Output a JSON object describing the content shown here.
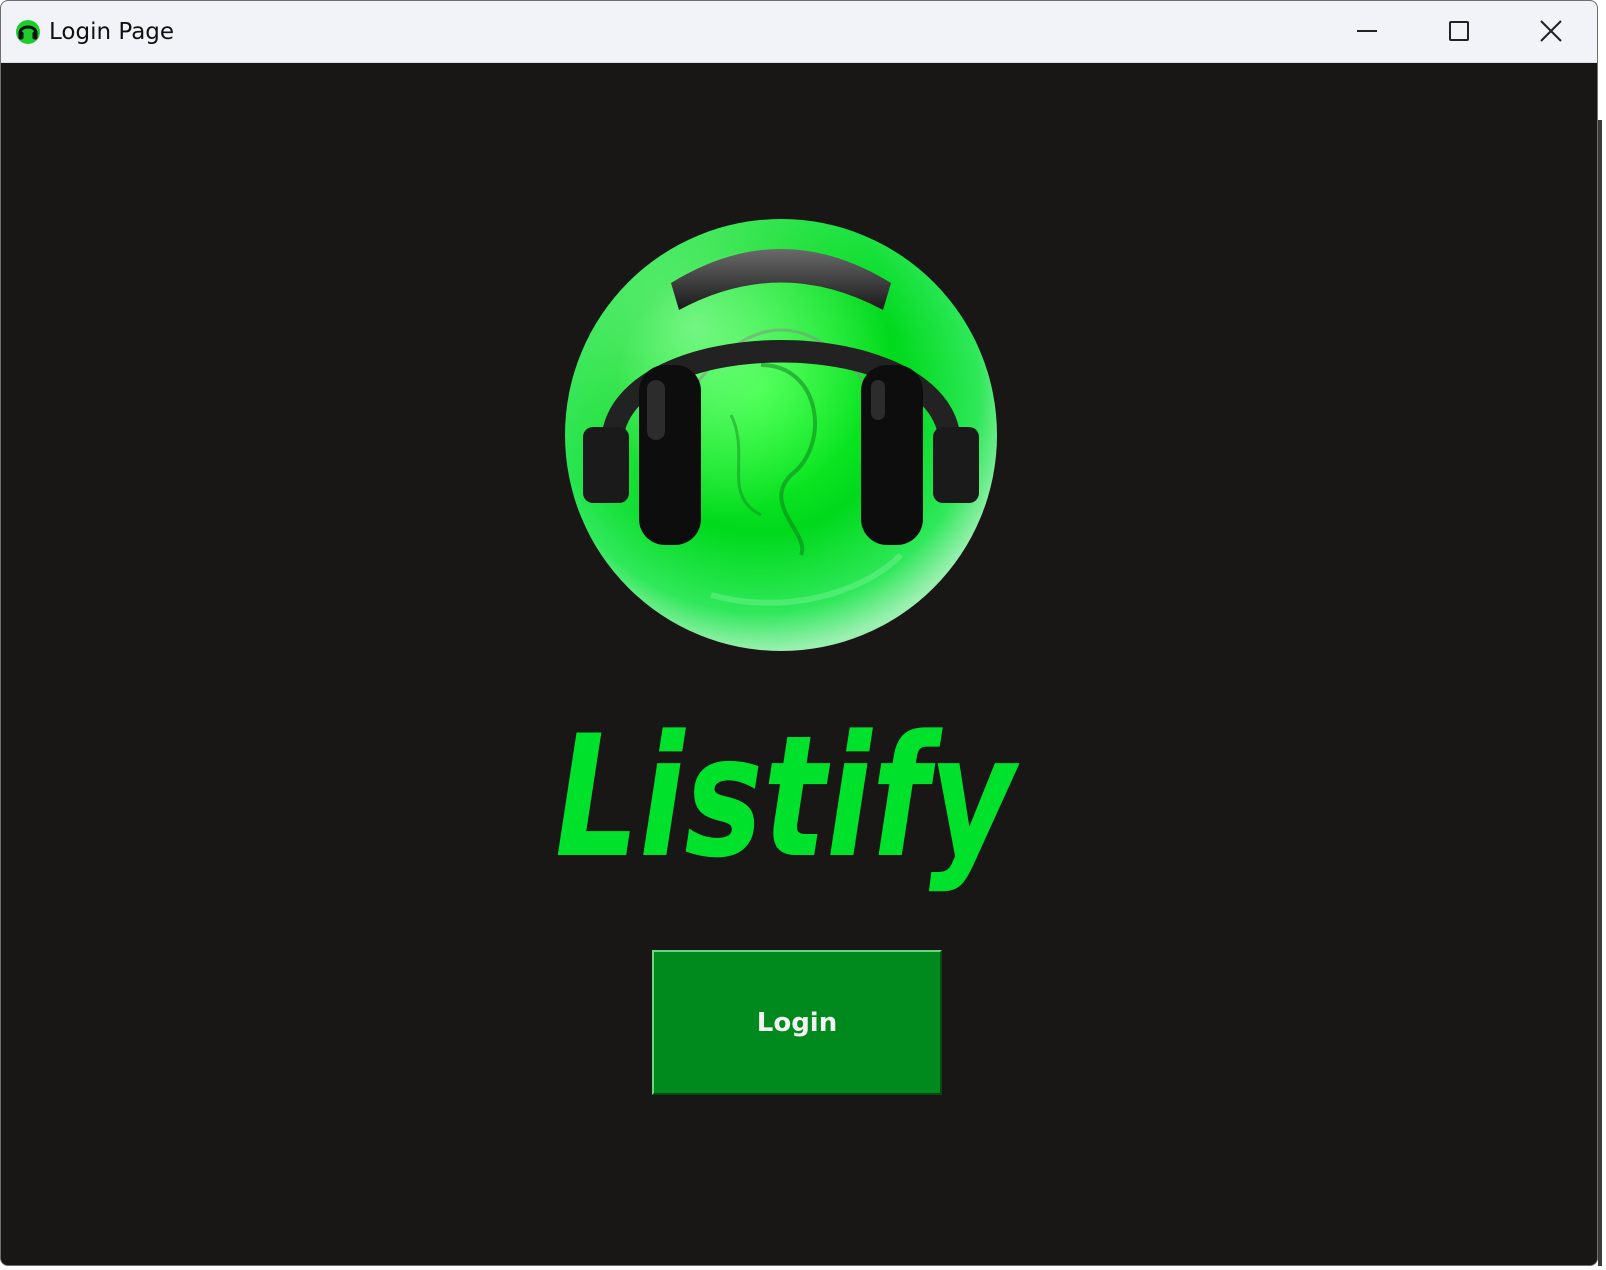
{
  "window": {
    "title": "Login Page",
    "controls": {
      "minimize": "minimize-icon",
      "maximize": "maximize-icon",
      "close": "close-icon"
    }
  },
  "app": {
    "brand_name": "Listify",
    "login_label": "Login"
  },
  "colors": {
    "background": "#191616",
    "accent_green": "#00e12b",
    "button_green": "#008a1e",
    "button_text": "#f2f2f2",
    "titlebar": "#f1f3f8"
  }
}
